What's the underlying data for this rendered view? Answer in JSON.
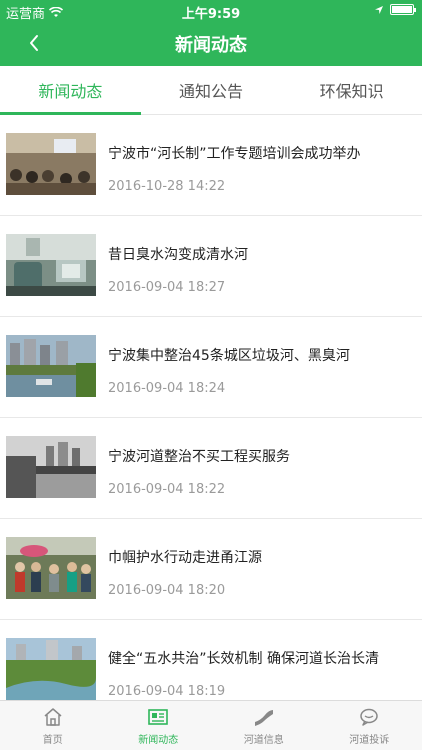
{
  "status": {
    "carrier": "运营商",
    "time": "上午9:59"
  },
  "nav": {
    "title": "新闻动态"
  },
  "tabs": [
    {
      "label": "新闻动态"
    },
    {
      "label": "通知公告"
    },
    {
      "label": "环保知识"
    }
  ],
  "news": [
    {
      "title": "宁波市“河长制”工作专题培训会成功举办",
      "date": "2016-10-28 14:22"
    },
    {
      "title": "昔日臭水沟变成清水河",
      "date": "2016-09-04 18:27"
    },
    {
      "title": "宁波集中整治45条城区垃圾河、黑臭河",
      "date": "2016-09-04 18:24"
    },
    {
      "title": "宁波河道整治不买工程买服务",
      "date": "2016-09-04 18:22"
    },
    {
      "title": "巾帼护水行动走进甬江源",
      "date": "2016-09-04 18:20"
    },
    {
      "title": "健全“五水共治”长效机制 确保河道长治长清",
      "date": "2016-09-04 18:19"
    }
  ],
  "tabbar": [
    {
      "label": "首页",
      "icon": "home-icon"
    },
    {
      "label": "新闻动态",
      "icon": "news-icon"
    },
    {
      "label": "河道信息",
      "icon": "river-icon"
    },
    {
      "label": "河道投诉",
      "icon": "chat-icon"
    }
  ],
  "colors": {
    "accent": "#2fb65a"
  }
}
